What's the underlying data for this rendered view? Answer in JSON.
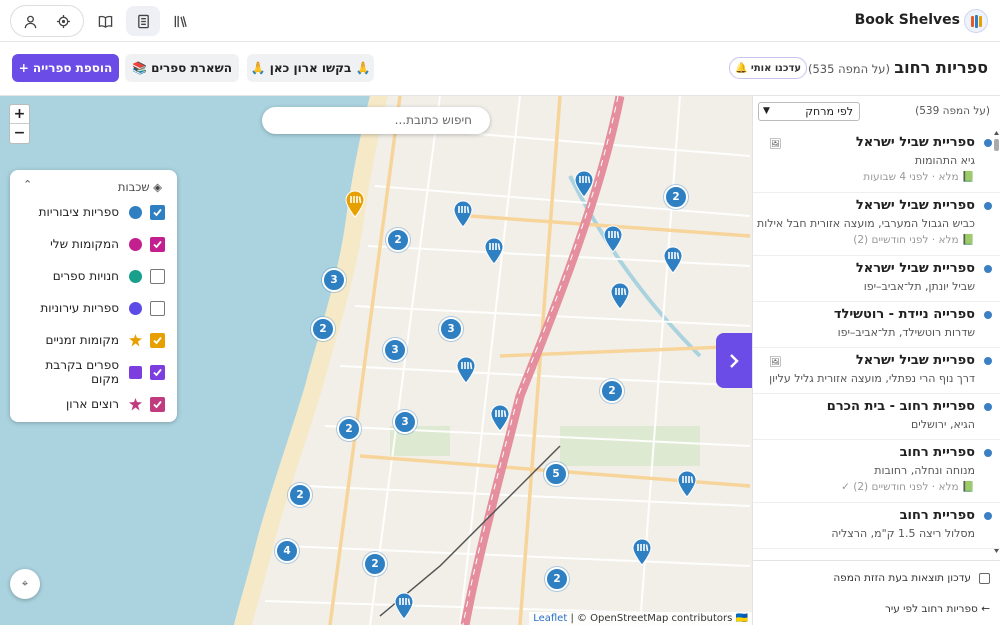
{
  "brand": {
    "name": "Book Shelves"
  },
  "actions": {
    "add_library": "+ הוספת ספרייה",
    "leave_books": "📚 השארת ספרים",
    "request_shelf": "🙏 בקשו ארון כאן 🙏",
    "update_me": "🔔 עדכנו אותי",
    "map_count": "(535 על המפה)",
    "title": "ספריות רחוב"
  },
  "map": {
    "search_placeholder": "חיפוש כתובת...",
    "zoom_in": "+",
    "zoom_out": "−",
    "attribution_leaflet": "Leaflet",
    "attribution_rest": "| © OpenStreetMap contributors 🇺🇦"
  },
  "layers": {
    "title": "שכבות",
    "items": [
      {
        "label": "ספריות ציבוריות",
        "checked": true,
        "color": "#2f7fc3"
      },
      {
        "label": "המקומות שלי",
        "checked": true,
        "color": "#c41f8f"
      },
      {
        "label": "חנויות ספרים",
        "checked": false,
        "color": "#19a08c"
      },
      {
        "label": "ספריות עירוניות",
        "checked": false,
        "color": "#5c4be6"
      },
      {
        "label": "מקומות זמניים",
        "checked": true,
        "color": "#e8a000"
      },
      {
        "label": "ספרים בקרבת מקום",
        "checked": true,
        "color": "#7d3ee0"
      },
      {
        "label": "רוצים ארון",
        "checked": true,
        "color": "#c13c7e"
      }
    ]
  },
  "side": {
    "sort": "לפי מרחק",
    "count": "(539 על המפה)",
    "auto_update": "עדכון תוצאות בעת הזזת המפה",
    "by_city": "ספריות רחוב לפי עיר ←"
  },
  "items": [
    {
      "title": "ספריית שביל ישראל",
      "sub": "גיא התהומות",
      "meta": "📗 מלא · לפני 4 שבועות",
      "photo": "🖼"
    },
    {
      "title": "ספריית שביל ישראל",
      "sub": "כביש הגבול המערבי, מועצה אזורית חבל אילות",
      "meta": "📗 מלא · לפני חודשיים (2)",
      "photo": ""
    },
    {
      "title": "ספריית שביל ישראל",
      "sub": "שביל יונתן, תל־אביב–יפו",
      "meta": "",
      "photo": ""
    },
    {
      "title": "ספרייה ניידת - רוטשילד",
      "sub": "שדרות רוטשילד, תל־אביב–יפו",
      "meta": "",
      "photo": ""
    },
    {
      "title": "ספריית שביל ישראל",
      "sub": "דרך נוף הרי נפתלי, מועצה אזורית גליל עליון",
      "meta": "",
      "photo": "🖼"
    },
    {
      "title": "ספריית רחוב - בית הכרם",
      "sub": "הגיא, ירושלים",
      "meta": "",
      "photo": ""
    },
    {
      "title": "ספריית רחוב",
      "sub": "מנוחה ונחלה, רחובות",
      "meta": "📗 מלא · לפני חודשיים (2) ✓",
      "photo": ""
    },
    {
      "title": "ספריית רחוב",
      "sub": "מסלול ריצה 1.5 ק\"מ, הרצליה",
      "meta": "",
      "photo": ""
    }
  ],
  "clusters": [
    "2",
    "2",
    "3",
    "2",
    "3",
    "3",
    "2",
    "3",
    "2",
    "5",
    "2",
    "4",
    "2",
    "2"
  ],
  "colors": {
    "accent": "#6c4ce6",
    "marker": "#2f7fc3",
    "cluster": "#2f7fc3",
    "temp": "#e8a000"
  }
}
